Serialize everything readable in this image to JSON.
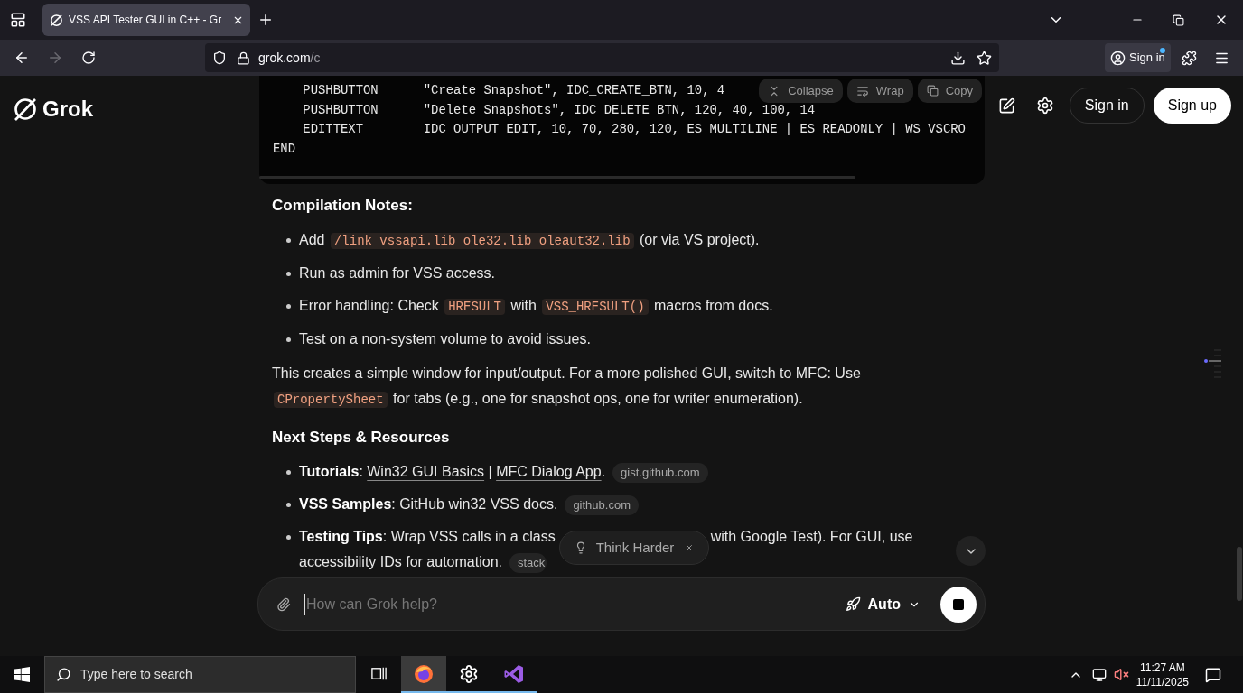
{
  "browser": {
    "tab": {
      "title": "VSS API Tester GUI in C++ - Gr",
      "selected": true
    },
    "forward_disabled": true,
    "url_host": "grok.com",
    "url_path": "/c",
    "account_label": "Sign in"
  },
  "header": {
    "logo": "Grok",
    "sign_in": "Sign in",
    "sign_up": "Sign up"
  },
  "code_block": {
    "lines": [
      "    PUSHBUTTON      \"Create Snapshot\", IDC_CREATE_BTN, 10, 4",
      "    PUSHBUTTON      \"Delete Snapshots\", IDC_DELETE_BTN, 120, 40, 100, 14",
      "    EDITTEXT        IDC_OUTPUT_EDIT, 10, 70, 280, 120, ES_MULTILINE | ES_READONLY | WS_VSCRO",
      "END"
    ],
    "actions": [
      {
        "kind": "collapse",
        "label": "Collapse"
      },
      {
        "kind": "wrap",
        "label": "Wrap"
      },
      {
        "kind": "copy",
        "label": "Copy"
      }
    ]
  },
  "sections": [
    {
      "kind": "heading",
      "text": "Compilation Notes:"
    },
    {
      "kind": "bullets",
      "items": [
        [
          {
            "kind": "text",
            "text": "Add "
          },
          {
            "kind": "code",
            "text": "/link vssapi.lib ole32.lib oleaut32.lib"
          },
          {
            "kind": "text",
            "text": " (or via VS project)."
          }
        ],
        [
          {
            "kind": "text",
            "text": "Run as admin for VSS access."
          }
        ],
        [
          {
            "kind": "text",
            "text": "Error handling: Check "
          },
          {
            "kind": "code",
            "text": "HRESULT"
          },
          {
            "kind": "text",
            "text": " with "
          },
          {
            "kind": "code",
            "text": "VSS_HRESULT()"
          },
          {
            "kind": "text",
            "text": " macros from docs."
          }
        ],
        [
          {
            "kind": "text",
            "text": "Test on a non-system volume to avoid issues."
          }
        ]
      ]
    },
    {
      "kind": "paragraph",
      "segments": [
        {
          "kind": "text",
          "text": "This creates a simple window for input/output. For a more polished GUI, switch to MFC: Use"
        },
        {
          "kind": "break"
        },
        {
          "kind": "code",
          "text": "CPropertySheet"
        },
        {
          "kind": "text",
          "text": " for tabs (e.g., one for snapshot ops, one for writer enumeration)."
        }
      ]
    },
    {
      "kind": "heading",
      "text": "Next Steps & Resources"
    },
    {
      "kind": "bullets",
      "items": [
        [
          {
            "kind": "bold",
            "text": "Tutorials"
          },
          {
            "kind": "text",
            "text": ": "
          },
          {
            "kind": "link",
            "text": "Win32 GUI Basics"
          },
          {
            "kind": "text",
            "text": " | "
          },
          {
            "kind": "link",
            "text": "MFC Dialog App"
          },
          {
            "kind": "text",
            "text": "."
          },
          {
            "kind": "chip",
            "text": "gist.github.com"
          }
        ],
        [
          {
            "kind": "bold",
            "text": "VSS Samples"
          },
          {
            "kind": "text",
            "text": ": GitHub "
          },
          {
            "kind": "link",
            "text": "win32 VSS docs"
          },
          {
            "kind": "text",
            "text": "."
          },
          {
            "kind": "chip",
            "text": "github.com"
          }
        ],
        [
          {
            "kind": "bold",
            "text": "Testing Tips"
          },
          {
            "kind": "text",
            "text": ": Wrap VSS calls in a class"
          },
          {
            "kind": "gap"
          },
          {
            "kind": "text",
            "text": "with Google Test). For GUI, use"
          },
          {
            "kind": "break"
          },
          {
            "kind": "text",
            "text": "accessibility IDs for automation."
          },
          {
            "kind": "chip",
            "text": "stack"
          }
        ]
      ]
    }
  ],
  "suggestion": {
    "label": "Think Harder"
  },
  "composer": {
    "placeholder": "How can Grok help?",
    "mode": "Auto"
  },
  "taskbar": {
    "search_placeholder": "Type here to search",
    "apps": [
      {
        "kind": "taskview",
        "running": false,
        "selected": false
      },
      {
        "kind": "browser",
        "running": true,
        "selected": true
      },
      {
        "kind": "settings",
        "running": true,
        "selected": false
      },
      {
        "kind": "editor",
        "running": true,
        "selected": false
      }
    ],
    "time": "11:27 AM",
    "date": "11/11/2025",
    "muted": true
  }
}
